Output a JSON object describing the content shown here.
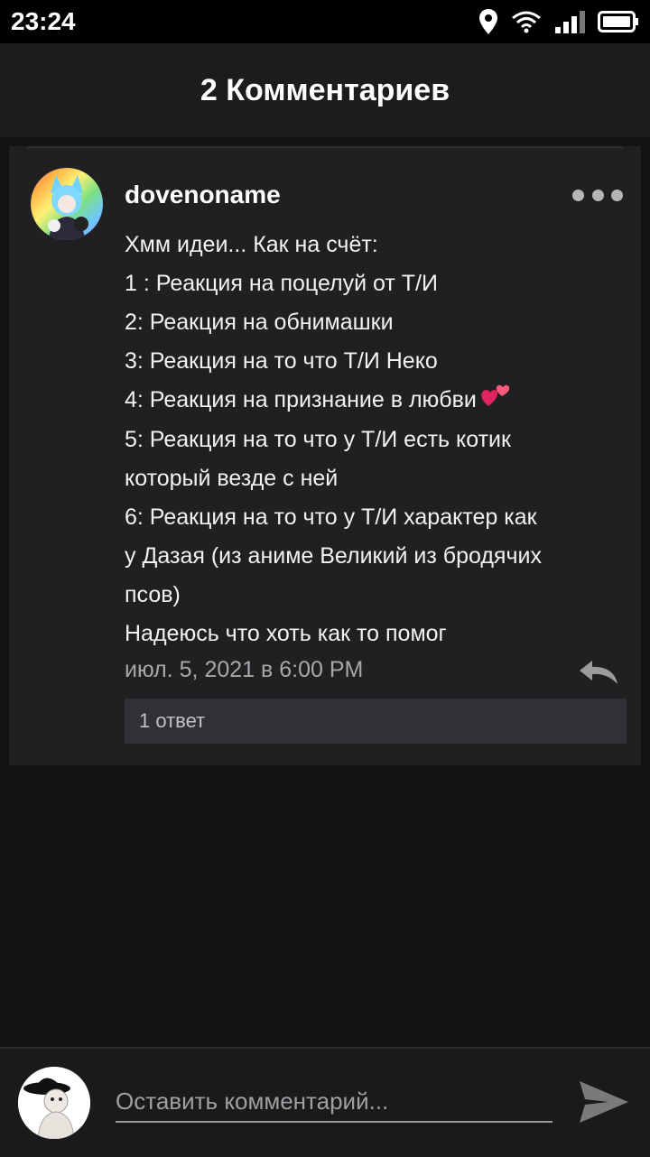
{
  "status_bar": {
    "time": "23:24"
  },
  "header": {
    "title": "2 Комментариев"
  },
  "comment": {
    "username": "dovenoname",
    "lines": [
      "Хмм идеи... Как на счёт:",
      "1 : Реакция на поцелуй от Т/И",
      "2: Реакция на обнимашки",
      "3: Реакция на то что Т/И Неко",
      "4: Реакция на  признание в любви",
      "5: Реакция на то что у Т/И есть котик",
      "который везде с ней",
      "6: Реакция на то что у Т/И характер как",
      "у Дазая (из аниме Великий из бродячих",
      "псов)",
      "Надеюсь что хоть как то помог"
    ],
    "emoji_after_line_5": "two-hearts",
    "timestamp": "июл. 5, 2021 в 6:00 PM",
    "replies_label": "1 ответ"
  },
  "composer": {
    "placeholder": "Оставить комментарий..."
  },
  "icons": {
    "status": [
      "location-icon",
      "wifi-icon",
      "signal-icon",
      "battery-icon"
    ],
    "more": "more-dots-icon",
    "reply": "reply-arrow-icon",
    "send": "send-icon"
  },
  "colors": {
    "background": "#141215",
    "card": "#201f22",
    "header": "#1c1b1d",
    "reply_button": "#313034"
  }
}
